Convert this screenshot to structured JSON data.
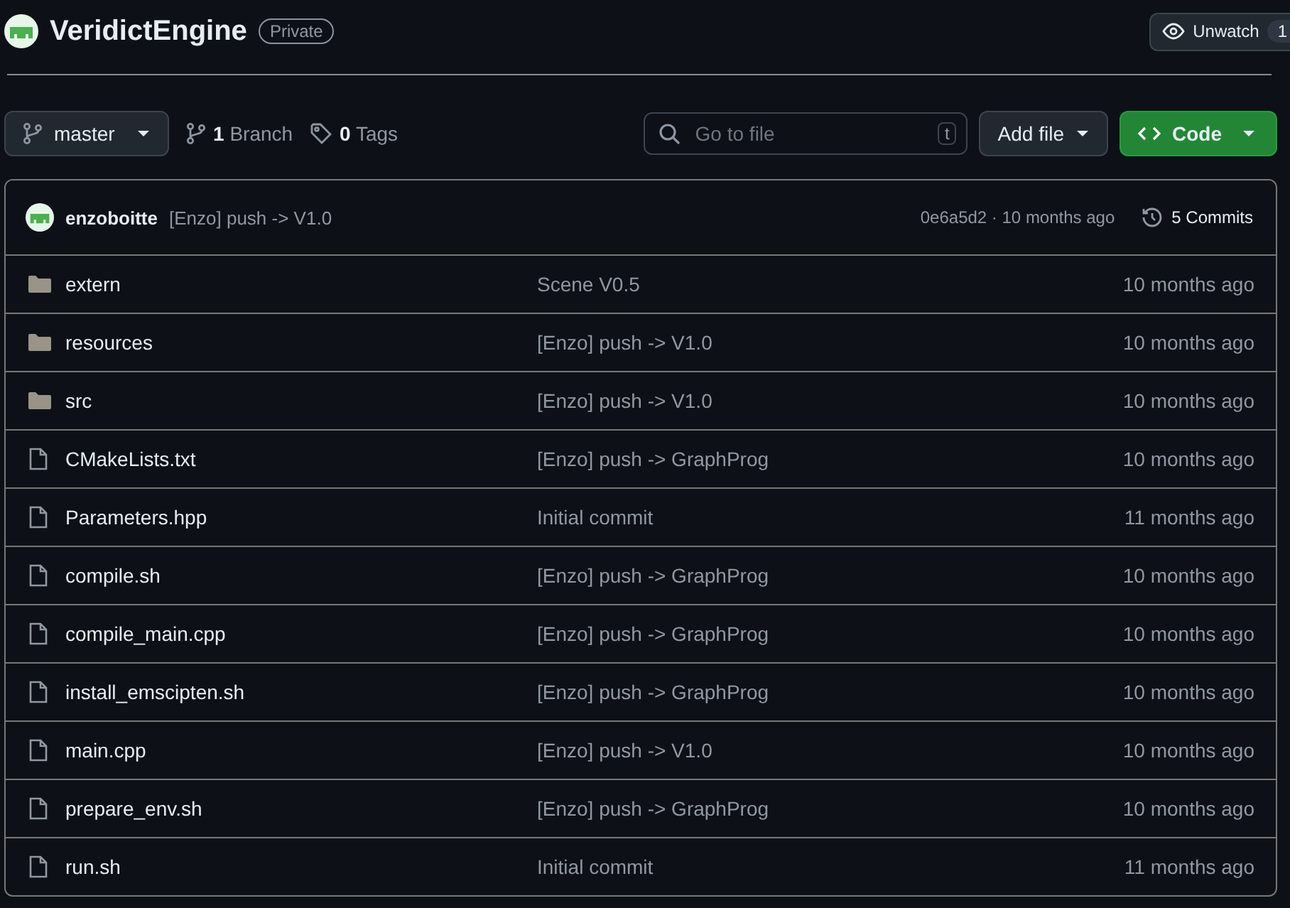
{
  "repo": {
    "name": "VeridictEngine",
    "visibility": "Private",
    "watch": {
      "label": "Unwatch",
      "count": "1"
    }
  },
  "toolbar": {
    "branch": "master",
    "branches": {
      "count": "1",
      "label": "Branch"
    },
    "tags": {
      "count": "0",
      "label": "Tags"
    },
    "search": {
      "placeholder": "Go to file",
      "shortcut": "t"
    },
    "add_file": "Add file",
    "code": "Code"
  },
  "last_commit": {
    "author": "enzoboitte",
    "message": "[Enzo] push -> V1.0",
    "hash": "0e6a5d2",
    "separator": "·",
    "time": "10 months ago",
    "commits": "5 Commits"
  },
  "files": [
    {
      "kind": "folder",
      "name": "extern",
      "message": "Scene V0.5",
      "time": "10 months ago"
    },
    {
      "kind": "folder",
      "name": "resources",
      "message": "[Enzo] push -> V1.0",
      "time": "10 months ago"
    },
    {
      "kind": "folder",
      "name": "src",
      "message": "[Enzo] push -> V1.0",
      "time": "10 months ago"
    },
    {
      "kind": "file",
      "name": "CMakeLists.txt",
      "message": "[Enzo] push -> GraphProg",
      "time": "10 months ago"
    },
    {
      "kind": "file",
      "name": "Parameters.hpp",
      "message": "Initial commit",
      "time": "11 months ago"
    },
    {
      "kind": "file",
      "name": "compile.sh",
      "message": "[Enzo] push -> GraphProg",
      "time": "10 months ago"
    },
    {
      "kind": "file",
      "name": "compile_main.cpp",
      "message": "[Enzo] push -> GraphProg",
      "time": "10 months ago"
    },
    {
      "kind": "file",
      "name": "install_emscipten.sh",
      "message": "[Enzo] push -> GraphProg",
      "time": "10 months ago"
    },
    {
      "kind": "file",
      "name": "main.cpp",
      "message": "[Enzo] push -> V1.0",
      "time": "10 months ago"
    },
    {
      "kind": "file",
      "name": "prepare_env.sh",
      "message": "[Enzo] push -> GraphProg",
      "time": "10 months ago"
    },
    {
      "kind": "file",
      "name": "run.sh",
      "message": "Initial commit",
      "time": "11 months ago"
    }
  ]
}
